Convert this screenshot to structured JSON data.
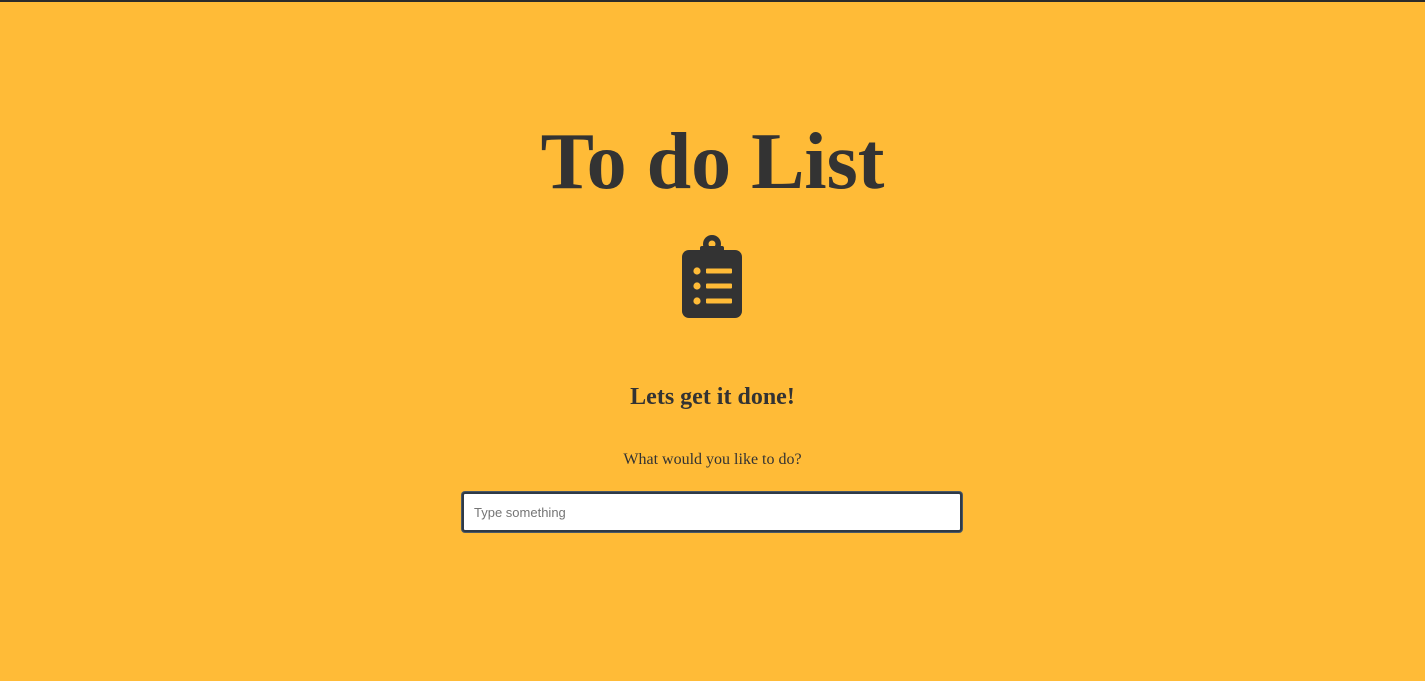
{
  "header": {
    "title": "To do List",
    "icon": "clipboard-list-icon"
  },
  "main": {
    "subtitle": "Lets get it done!",
    "prompt": "What would you like to do?",
    "input": {
      "value": "",
      "placeholder": "Type something"
    }
  },
  "colors": {
    "background": "#ffbb37",
    "text": "#333333",
    "input_border": "#2f3a47",
    "input_background": "#ffffff"
  }
}
